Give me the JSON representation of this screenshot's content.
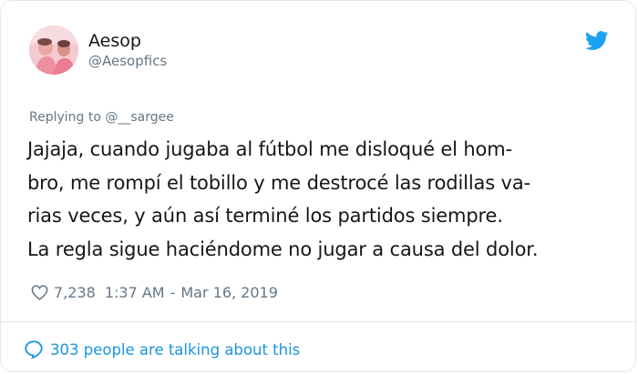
{
  "author": {
    "name": "Aesop",
    "handle": "@Aesopfics",
    "avatar_icon": "avatar-photo"
  },
  "reply_context": "Replying to @__sargee",
  "tweet": {
    "lines": [
      "Jajaja, cuando jugaba al fútbol me disloqué el hom-",
      "bro, me rompí el tobillo y me destrocé las rodillas va-",
      "rias veces, y aún así terminé los partidos siempre.",
      "La regla sigue haciéndome no jugar a causa del dolor."
    ]
  },
  "meta": {
    "likes": "7,238",
    "time": "1:37 AM",
    "separator": "-",
    "date": "Mar 16, 2019"
  },
  "footer": {
    "talking": "303 people are talking about this"
  },
  "colors": {
    "text": "#14171a",
    "secondary": "#657786",
    "link": "#1b95e0",
    "twitter_blue": "#1da1f2",
    "border": "#e1e8ed"
  },
  "icons": [
    "twitter-bird-icon",
    "heart-icon",
    "speech-bubble-icon"
  ]
}
